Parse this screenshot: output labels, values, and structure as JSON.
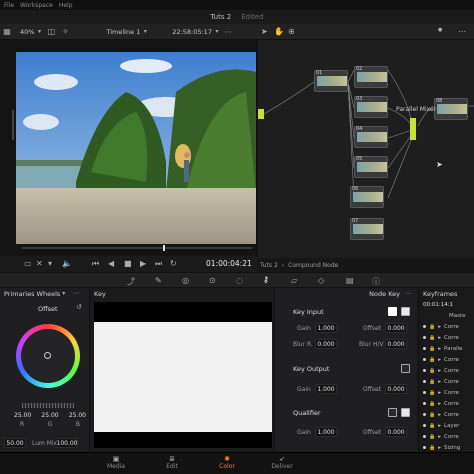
{
  "menu": [
    "File",
    "Workspace",
    "Help"
  ],
  "title": {
    "project": "Tuts 2",
    "status": "Edited"
  },
  "viewer_toolbar": {
    "zoom": "40%",
    "timeline": "Timeline 1",
    "timecode": "22:58:05:17"
  },
  "transport": {
    "timecode": "01:00:04:21"
  },
  "node_breadcrumb": {
    "project": "Tuts 2",
    "level": "Compound Node"
  },
  "nodes": [
    {
      "num": "01",
      "label": ""
    },
    {
      "num": "02",
      "label": ""
    },
    {
      "num": "03",
      "label": ""
    },
    {
      "num": "04",
      "label": ""
    },
    {
      "num": "05",
      "label": ""
    },
    {
      "num": "06",
      "label": ""
    },
    {
      "num": "07",
      "label": ""
    },
    {
      "num": "08",
      "label": ""
    }
  ],
  "parallel_mixer_label": "Parallel Mixer",
  "wheels": {
    "header": "Primaries Wheels",
    "wheel_label": "Offset",
    "values": [
      "25.00",
      "25.00",
      "25.00"
    ],
    "channels": [
      "R",
      "G",
      "B"
    ],
    "bottom_left": "50.00",
    "lum_mix_label": "Lum Mix",
    "lum_mix_value": "100.00"
  },
  "key_panel": {
    "header": "Key"
  },
  "node_key": {
    "header": "Node Key",
    "key_input": {
      "title": "Key Input",
      "gain_label": "Gain",
      "gain": "1.000",
      "offset_label": "Offset",
      "offset": "0.000",
      "blur_r_label": "Blur R.",
      "blur_r": "0.000",
      "blur_hv_label": "Blur H/V",
      "blur_hv": "0.000"
    },
    "key_output": {
      "title": "Key Output",
      "gain_label": "Gain",
      "gain": "1.000",
      "offset_label": "Offset",
      "offset": "0.000"
    },
    "qualifier": {
      "title": "Qualifier",
      "gain_label": "Gain",
      "gain": "1.000",
      "offset_label": "Offset",
      "offset": "0.000"
    }
  },
  "keyframes": {
    "header": "Keyframes",
    "timecode": "00:01:14:1",
    "master": "Maste",
    "rows": [
      "Corre",
      "Corre",
      "Paralle",
      "Corre",
      "Corre",
      "Corre",
      "Corre",
      "Corre",
      "Corre",
      "Layer",
      "Corre",
      "Sizing"
    ]
  },
  "pages": [
    {
      "label": "Media",
      "active": false
    },
    {
      "label": "Edit",
      "active": false
    },
    {
      "label": "Color",
      "active": true
    },
    {
      "label": "Deliver",
      "active": false
    }
  ],
  "colors": {
    "accent": "#ff7a3c",
    "node_link": "#c7e03a"
  }
}
